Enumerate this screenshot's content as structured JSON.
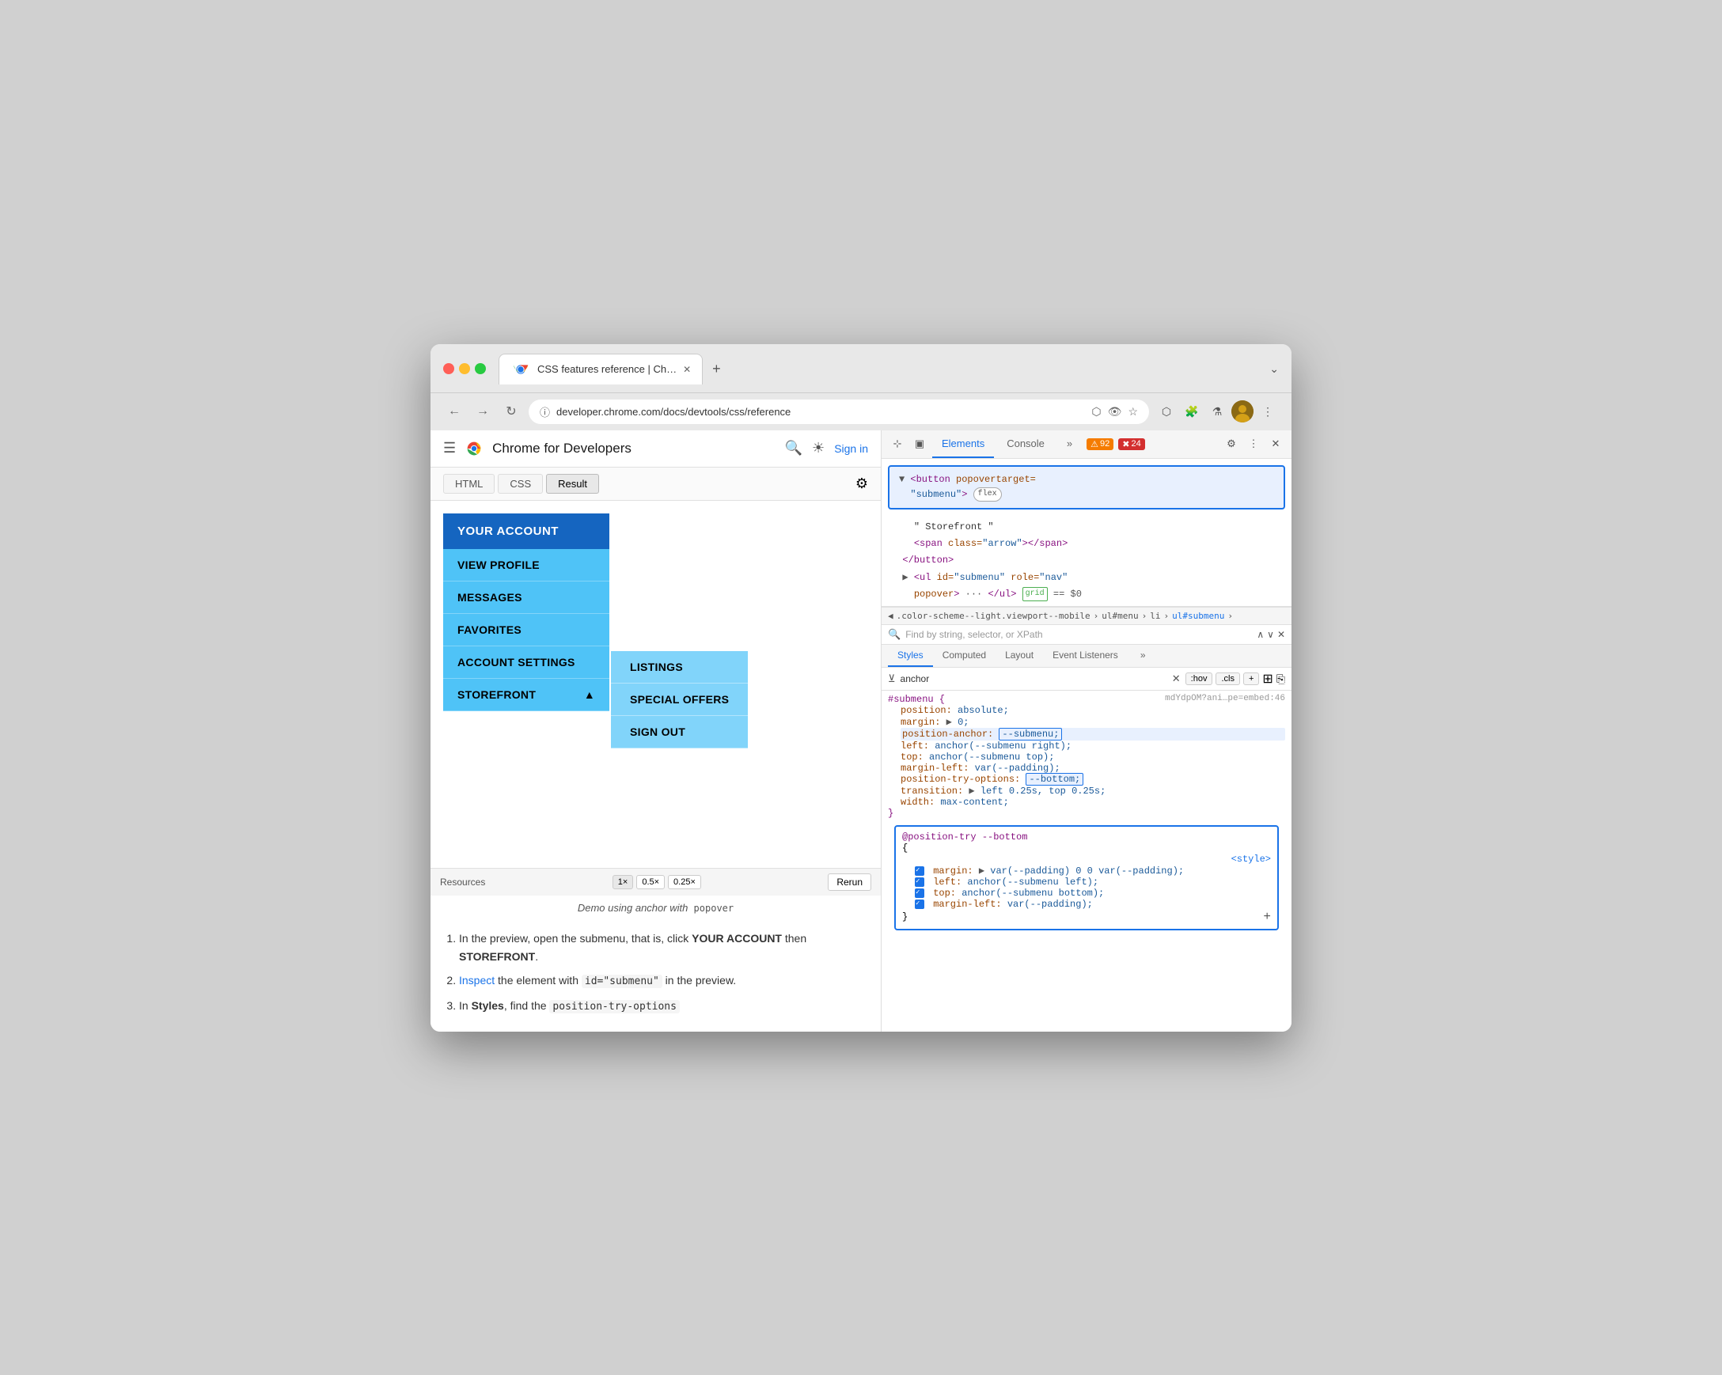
{
  "browser": {
    "tab_title": "CSS features reference | Ch…",
    "url": "developer.chrome.com/docs/devtools/css/reference",
    "new_tab_icon": "+",
    "chevron": "⌄"
  },
  "webpage": {
    "site_title": "Chrome for Developers",
    "code_tabs": [
      "HTML",
      "CSS",
      "Result"
    ],
    "active_tab": "Result",
    "menu": {
      "header": "YOUR ACCOUNT",
      "items": [
        "VIEW PROFILE",
        "MESSAGES",
        "FAVORITES",
        "ACCOUNT SETTINGS",
        "STOREFRONT"
      ],
      "storefront_arrow": "▲"
    },
    "submenu": {
      "items": [
        "LISTINGS",
        "SPECIAL OFFERS",
        "SIGN OUT"
      ]
    },
    "demo_bar": {
      "resources_label": "Resources",
      "scales": [
        "1×",
        "0.5×",
        "0.25×"
      ],
      "rerun": "Rerun"
    },
    "caption": "Demo using anchor with  popover",
    "instructions": [
      {
        "num": 1,
        "text_parts": [
          {
            "type": "text",
            "val": "In the preview, open the submenu, that is, click "
          },
          {
            "type": "bold",
            "val": "YOUR ACCOUNT"
          },
          {
            "type": "text",
            "val": " then "
          },
          {
            "type": "bold",
            "val": "STOREFRONT"
          },
          {
            "type": "text",
            "val": "."
          }
        ]
      },
      {
        "num": 2,
        "text_parts": [
          {
            "type": "link",
            "val": "Inspect"
          },
          {
            "type": "text",
            "val": " the element with "
          },
          {
            "type": "code",
            "val": "id=\"submenu\""
          },
          {
            "type": "text",
            "val": " in the preview."
          }
        ]
      },
      {
        "num": 3,
        "text_parts": [
          {
            "type": "text",
            "val": "In "
          },
          {
            "type": "bold",
            "val": "Styles"
          },
          {
            "type": "text",
            "val": ", find the "
          },
          {
            "type": "code",
            "val": "position-try-options"
          }
        ]
      }
    ]
  },
  "devtools": {
    "tabs": [
      "Elements",
      "Console",
      "»"
    ],
    "active_tab": "Elements",
    "badges": {
      "warning": {
        "icon": "⚠",
        "count": "92"
      },
      "error": {
        "icon": "✖",
        "count": "24"
      }
    },
    "elements_html": [
      "<button popovertarget= \"submenu\"> flex",
      "\" Storefront \"",
      "<span class=\"arrow\"></span>",
      "</button>",
      "▶ <ul id=\"submenu\" role=\"nav\"",
      "popover> ··· </ul> grid  == $0"
    ],
    "breadcrumb": [
      ".color-scheme--light.viewport--mobile",
      "ul#menu",
      "li",
      "ul#submenu"
    ],
    "search_placeholder": "Find by string, selector, or XPath",
    "styles_tabs": [
      "Styles",
      "Computed",
      "Layout",
      "Event Listeners",
      "»"
    ],
    "active_styles_tab": "Styles",
    "filter_text": "anchor",
    "filter_btns": [
      ":hov",
      ".cls",
      "+"
    ],
    "css_rules": {
      "selector": "#submenu {",
      "file_ref": "mdYdpOM?ani…pe=embed:46",
      "properties": [
        {
          "prop": "position:",
          "val": "absolute;"
        },
        {
          "prop": "margin:",
          "val": "▶ 0;"
        },
        {
          "prop": "position-anchor:",
          "val": "--submenu;",
          "highlight": true
        },
        {
          "prop": "left:",
          "val": "anchor(--submenu right);"
        },
        {
          "prop": "top:",
          "val": "anchor(--submenu top);"
        },
        {
          "prop": "margin-left:",
          "val": "var(--padding);"
        },
        {
          "prop": "position-try-options:",
          "val": "--bottom;",
          "highlight": true
        },
        {
          "prop": "transition:",
          "val": "▶ left 0.25s, top 0.25s;"
        },
        {
          "prop": "width:",
          "val": "max-content;"
        }
      ]
    },
    "pos_try_block": {
      "selector": "@position-try --bottom",
      "opening": "{",
      "file_ref": "<style>",
      "properties": [
        {
          "prop": "margin:",
          "val": "▶ var(--padding) 0 0 var(--padding);"
        },
        {
          "prop": "left:",
          "val": "anchor(--submenu left);"
        },
        {
          "prop": "top:",
          "val": "anchor(--submenu bottom);"
        },
        {
          "prop": "margin-left:",
          "val": "var(--padding);"
        }
      ],
      "closing": "}"
    }
  }
}
